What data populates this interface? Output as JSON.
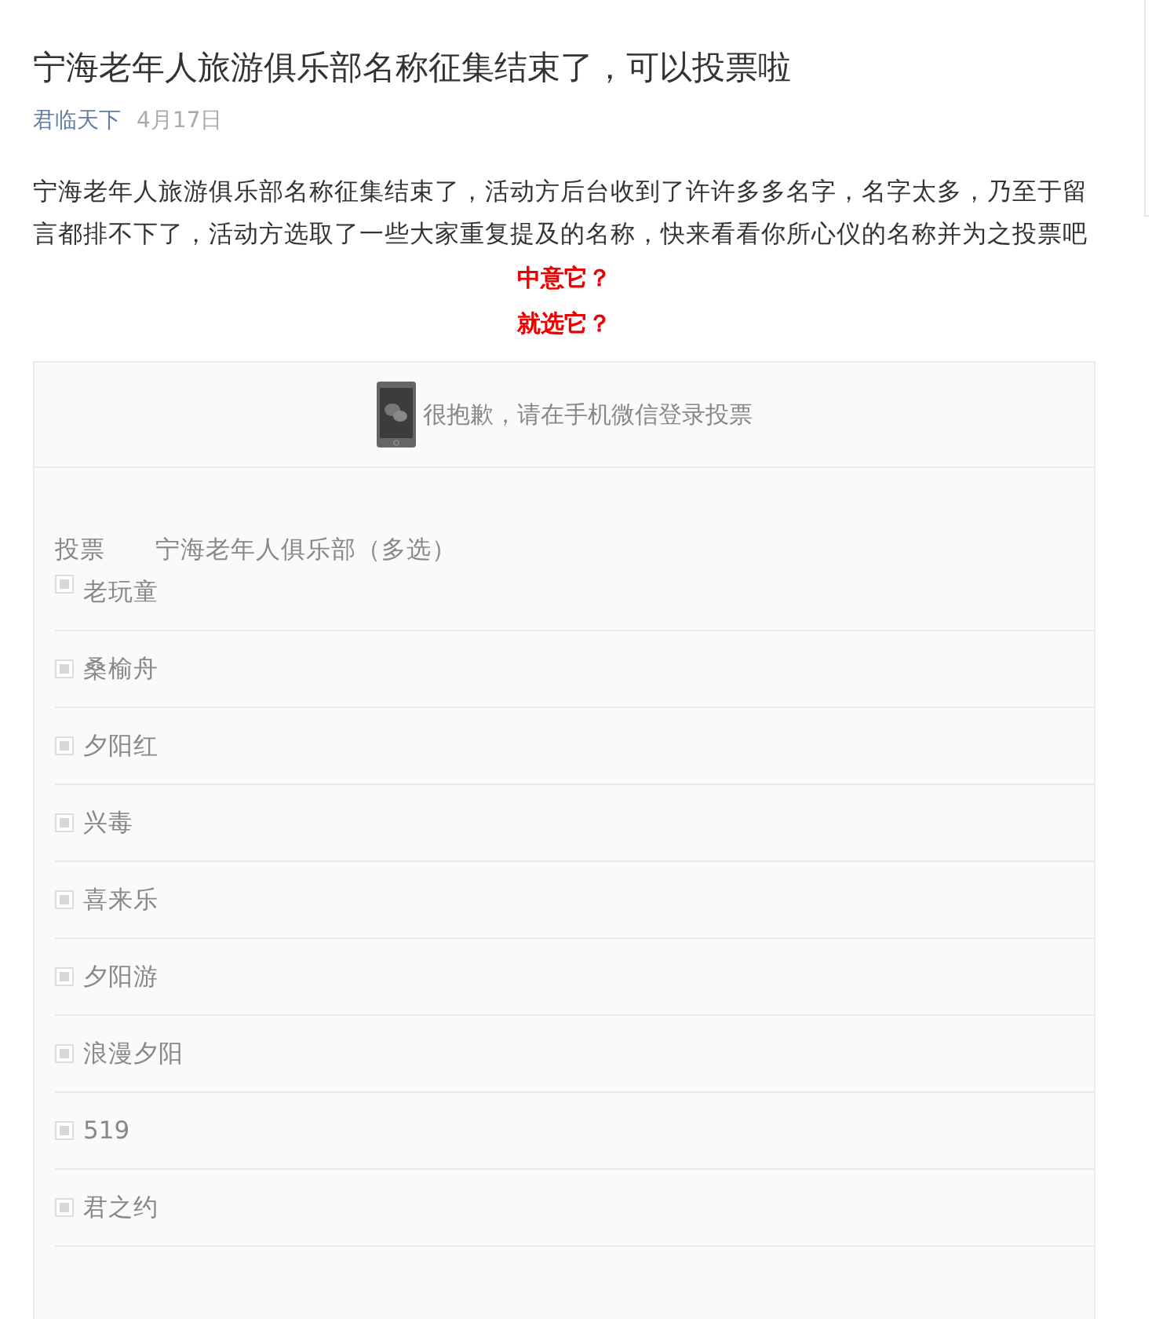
{
  "article": {
    "title": "宁海老年人旅游俱乐部名称征集结束了，可以投票啦",
    "author": "君临天下",
    "date": "4月17日",
    "body": "宁海老年人旅游俱乐部名称征集结束了，活动方后台收到了许许多多名字，名字太多，乃至于留言都排不下了，活动方选取了一些大家重复提及的名称，快来看看你所心仪的名称并为之投票吧",
    "highlights": [
      "中意它？",
      "就选它？"
    ]
  },
  "vote": {
    "notice": "很抱歉，请在手机微信登录投票",
    "label": "投票",
    "question": "宁海老年人俱乐部（多选）",
    "options": [
      {
        "name": "老玩童",
        "checked": false
      },
      {
        "name": "桑榆舟",
        "checked": false
      },
      {
        "name": "夕阳红",
        "checked": false
      },
      {
        "name": "兴毒",
        "checked": false
      },
      {
        "name": "喜来乐",
        "checked": false
      },
      {
        "name": "夕阳游",
        "checked": false
      },
      {
        "name": "浪漫夕阳",
        "checked": false
      },
      {
        "name": "519",
        "checked": false
      },
      {
        "name": "君之约",
        "checked": false
      }
    ]
  }
}
